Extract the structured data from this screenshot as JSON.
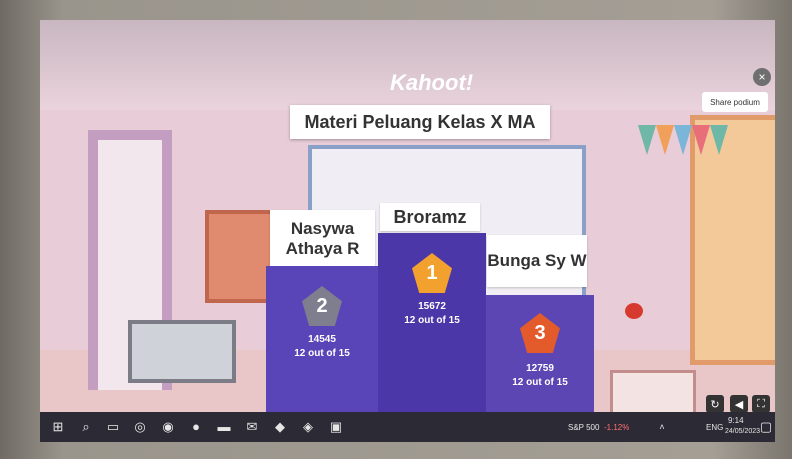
{
  "app": {
    "window_title": "Kahoot!",
    "logo": "Kahoot!"
  },
  "quiz": {
    "title": "Materi Peluang Kelas X MA"
  },
  "controls": {
    "share_label": "Share podium",
    "close_icon": "×"
  },
  "podium": [
    {
      "rank": "1",
      "name": "Broramz",
      "score": "15672",
      "correct": "12 out of 15",
      "color": "#f2a12e"
    },
    {
      "rank": "2",
      "name": "Nasywa Athaya R",
      "score": "14545",
      "correct": "12 out of 15",
      "color": "#7e7e8e"
    },
    {
      "rank": "3",
      "name": "Bunga Sy W",
      "score": "12759",
      "correct": "12 out of 15",
      "color": "#e35b2b"
    }
  ],
  "bottom_controls": [
    "restart-icon",
    "volume-icon",
    "fullscreen-icon"
  ],
  "taskbar": {
    "ticker": "S&P 500",
    "ticker_change": "-1.12%",
    "language": "ENG",
    "time": "9:14",
    "date": "24/05/2023"
  }
}
